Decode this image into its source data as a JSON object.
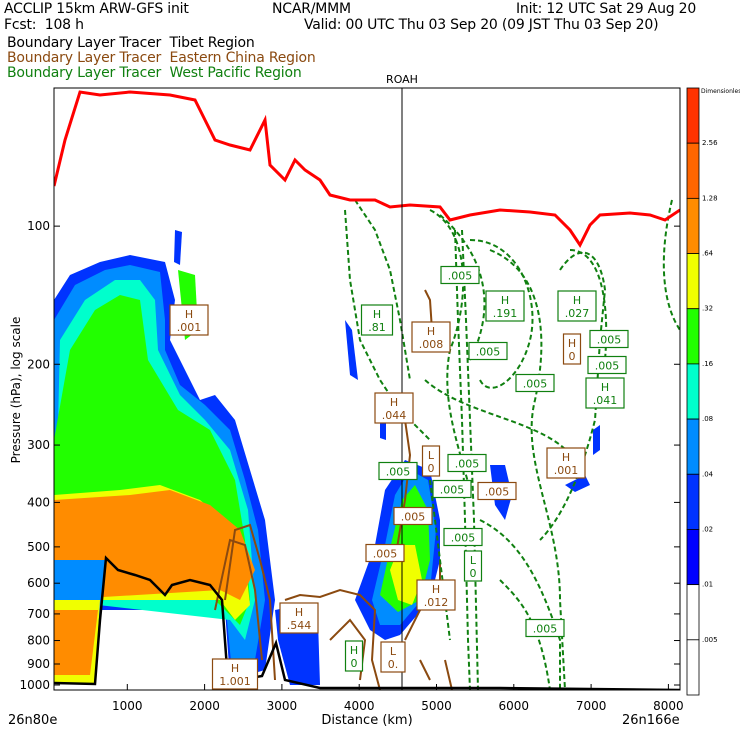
{
  "header": {
    "model": "ACCLIP 15km ARW-GFS init",
    "org": "NCAR/MMM",
    "init": "Init: 12 UTC Sat 29 Aug 20",
    "fcst": "Fcst:  108 h",
    "valid": "Valid: 00 UTC Thu 03 Sep 20 (09 JST Thu 03 Sep 20)",
    "legend": [
      {
        "label": "Boundary Layer Tracer  Tibet Region",
        "color": "#000000"
      },
      {
        "label": "Boundary Layer Tracer  Eastern China Region",
        "color": "#8b4a10"
      },
      {
        "label": "Boundary Layer Tracer  West Pacific Region",
        "color": "#108010"
      }
    ]
  },
  "chart_data": {
    "type": "heatmap",
    "title": "Boundary Layer Tracer cross-section",
    "xlabel": "Distance (km)",
    "ylabel": "Pressure (hPa), log scale",
    "x_ticks": [
      "1000",
      "2000",
      "3000",
      "4000",
      "5000",
      "6000",
      "7000",
      "8000"
    ],
    "y_ticks": [
      "100",
      "200",
      "300",
      "400",
      "500",
      "600",
      "700",
      "800",
      "900",
      "1000"
    ],
    "xlim": [
      0,
      8100
    ],
    "ylim": [
      1000,
      50
    ],
    "left_endpoint": "26n80e",
    "right_endpoint": "26n166e",
    "marker_label": "ROAH",
    "marker_x_km": 4560,
    "colorbar": {
      "unit": "Dimensionless",
      "levels": [
        "2.56",
        "1.28",
        ".64",
        ".32",
        ".16",
        ".08",
        ".04",
        ".02",
        ".01",
        ".005"
      ],
      "colors": [
        "#ff3300",
        "#ff6600",
        "#ff8c00",
        "#f0ff00",
        "#22ff00",
        "#00ffcc",
        "#008cff",
        "#0033ff",
        "#0000ff",
        "#ffffff",
        "#ffffff"
      ]
    },
    "contour_labels": [
      {
        "text": "H\n.001",
        "color": "#8b4a10"
      },
      {
        "text": "H\n.81",
        "color": "#108010"
      },
      {
        "text": "H\n.008",
        "color": "#8b4a10"
      },
      {
        "text": ".005",
        "color": "#108010"
      },
      {
        "text": "H\n.191",
        "color": "#108010"
      },
      {
        "text": "H\n.027",
        "color": "#108010"
      },
      {
        "text": ".005",
        "color": "#108010"
      },
      {
        "text": "H\n0",
        "color": "#8b4a10"
      },
      {
        "text": ".005",
        "color": "#108010"
      },
      {
        "text": ".005",
        "color": "#108010"
      },
      {
        "text": ".005",
        "color": "#108010"
      },
      {
        "text": "H\n.041",
        "color": "#108010"
      },
      {
        "text": "H\n.044",
        "color": "#8b4a10"
      },
      {
        "text": "H\n.001",
        "color": "#8b4a10"
      },
      {
        "text": ".005",
        "color": "#108010"
      },
      {
        "text": "L\n0",
        "color": "#8b4a10"
      },
      {
        "text": ".005",
        "color": "#108010"
      },
      {
        "text": ".005",
        "color": "#108010"
      },
      {
        "text": ".005",
        "color": "#8b4a10"
      },
      {
        "text": ".005",
        "color": "#8b4a10"
      },
      {
        "text": ".005",
        "color": "#108010"
      },
      {
        "text": ".005",
        "color": "#8b4a10"
      },
      {
        "text": "L\n0",
        "color": "#108010"
      },
      {
        "text": "H\n.012",
        "color": "#8b4a10"
      },
      {
        "text": "H\n.544",
        "color": "#8b4a10"
      },
      {
        "text": ".005",
        "color": "#108010"
      },
      {
        "text": "H\n0",
        "color": "#108010"
      },
      {
        "text": "L\n0.",
        "color": "#8b4a10"
      },
      {
        "text": "H\n1.001",
        "color": "#8b4a10"
      }
    ]
  }
}
